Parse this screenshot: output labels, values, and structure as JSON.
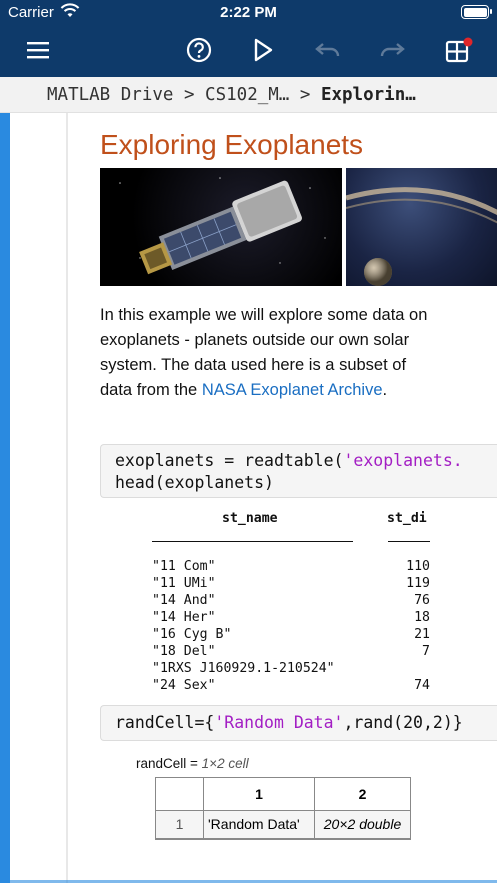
{
  "status": {
    "carrier": "Carrier",
    "time": "2:22 PM"
  },
  "toolbar": {
    "menu_icon": "hamburger-icon",
    "help_icon": "help-circle-icon",
    "run_icon": "play-icon",
    "undo_icon": "undo-icon",
    "redo_icon": "redo-icon",
    "grid_icon": "grid-plus-icon"
  },
  "breadcrumb": {
    "root": "MATLAB Drive",
    "sep1": " > ",
    "folder": "CS102_M…",
    "sep2": " > ",
    "current": "Explorin…"
  },
  "doc": {
    "title": "Exploring Exoplanets",
    "para_text": "In this example we will explore some data on exoplanets - planets outside our own solar system.  The data used here is a subset of data from the ",
    "para_link": "NASA Exoplanet Archive",
    "para_end": ".",
    "code1_line1_pre": "exoplanets = readtable(",
    "code1_line1_str": "'exoplanets.",
    "code1_line2": "head(exoplanets)",
    "table": {
      "col1_header": "st_name",
      "col2_header": "st_di",
      "rows": [
        {
          "name": "\"11 Com\"",
          "val": "110"
        },
        {
          "name": "\"11 UMi\"",
          "val": "119"
        },
        {
          "name": "\"14 And\"",
          "val": "76"
        },
        {
          "name": "\"14 Her\"",
          "val": "18"
        },
        {
          "name": "\"16 Cyg B\"",
          "val": "21"
        },
        {
          "name": "\"18 Del\"",
          "val": "7"
        },
        {
          "name": "\"1RXS J160929.1-210524\"",
          "val": ""
        },
        {
          "name": "\"24 Sex\"",
          "val": "74"
        }
      ]
    },
    "code2_pre": "randCell={",
    "code2_str": "'Random Data'",
    "code2_post": ",rand(20,2)}",
    "cell_label": "randCell = ",
    "cell_dims": "1×2 cell",
    "cell_table": {
      "col_headers": [
        "1",
        "2"
      ],
      "row_label": "1",
      "cells": [
        "'Random Data'",
        "20×2 double"
      ]
    }
  },
  "colors": {
    "appbar": "#0e3a6a",
    "title": "#c0501b",
    "link": "#1a6ec2",
    "string": "#a31ec4",
    "accent": "#2a8ae0"
  }
}
